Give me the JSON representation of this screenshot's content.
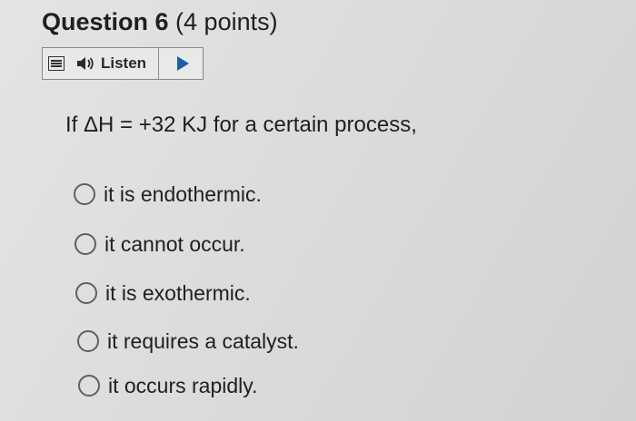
{
  "question": {
    "number_label": "Question 6",
    "points_label": "(4 points)"
  },
  "listen": {
    "label": "Listen",
    "menu_icon": "menu-icon",
    "speaker_icon": "speaker-icon",
    "play_icon": "play-icon"
  },
  "stem": "If ΔH = +32 KJ for a certain process,",
  "options": [
    {
      "label": "it is endothermic."
    },
    {
      "label": "it cannot occur."
    },
    {
      "label": "it is exothermic."
    },
    {
      "label": "it requires a catalyst."
    },
    {
      "label": "it occurs rapidly."
    }
  ],
  "colors": {
    "play_accent": "#1a5fa8",
    "text": "#1f1f1f"
  }
}
